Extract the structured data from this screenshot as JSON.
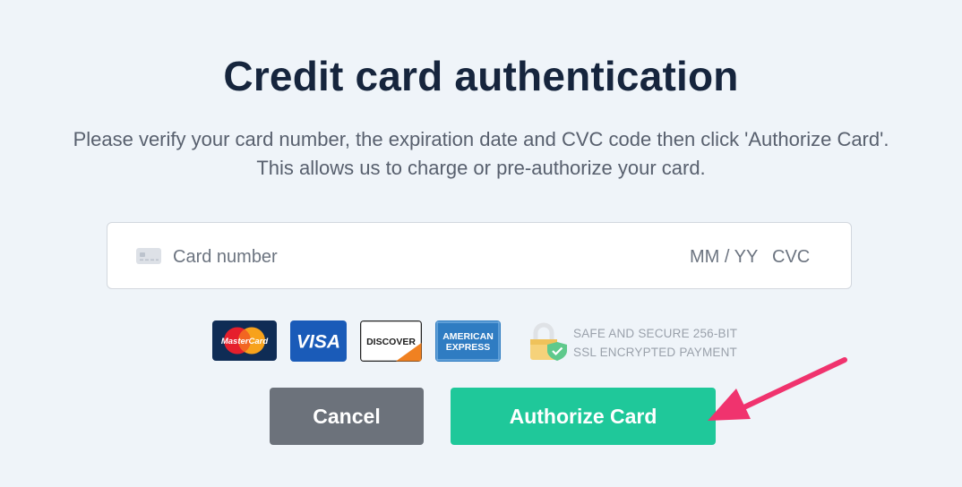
{
  "header": {
    "title": "Credit card authentication",
    "description": "Please verify your card number, the expiration date and CVC code then click 'Authorize Card'. This allows us to charge or pre-authorize your card."
  },
  "card_form": {
    "number_placeholder": "Card number",
    "expiry_placeholder": "MM / YY",
    "cvc_placeholder": "CVC"
  },
  "payment_logos": {
    "mastercard": "MasterCard",
    "visa": "VISA",
    "discover": "DISCOVER",
    "amex_line1": "AMERICAN",
    "amex_line2": "EXPRESS"
  },
  "security": {
    "line1": "SAFE AND SECURE 256-BIT",
    "line2": "SSL ENCRYPTED PAYMENT"
  },
  "actions": {
    "cancel_label": "Cancel",
    "authorize_label": "Authorize Card"
  },
  "colors": {
    "background": "#eff4f9",
    "authorize": "#1fc89a",
    "cancel": "#6c727b",
    "arrow": "#f0336e"
  }
}
